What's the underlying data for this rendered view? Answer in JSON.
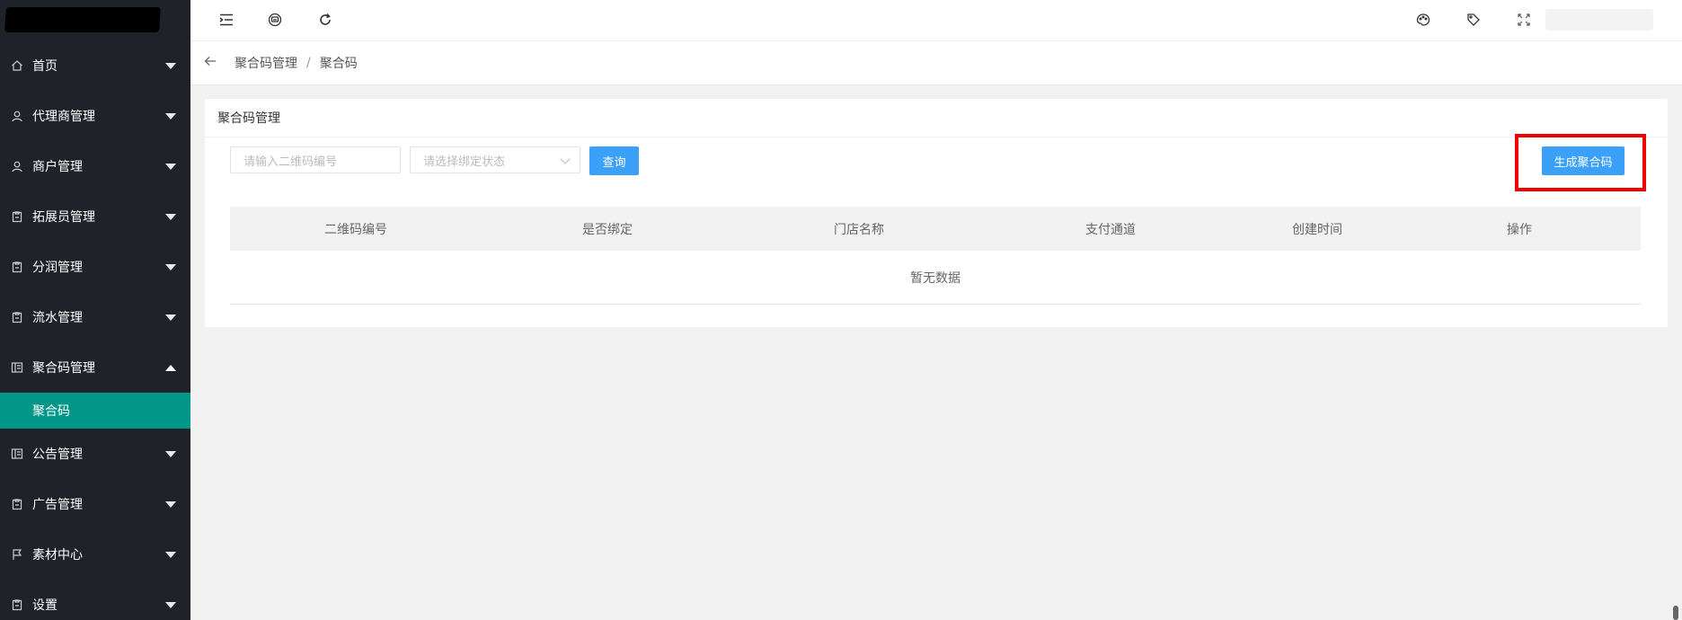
{
  "sidebar": {
    "items": [
      {
        "label": "首页",
        "icon": "home-icon",
        "state": "collapsed"
      },
      {
        "label": "代理商管理",
        "icon": "user-icon",
        "state": "collapsed"
      },
      {
        "label": "商户管理",
        "icon": "user-icon",
        "state": "collapsed"
      },
      {
        "label": "拓展员管理",
        "icon": "clipboard-icon",
        "state": "collapsed"
      },
      {
        "label": "分润管理",
        "icon": "clipboard-icon",
        "state": "collapsed"
      },
      {
        "label": "流水管理",
        "icon": "clipboard-icon",
        "state": "collapsed"
      },
      {
        "label": "聚合码管理",
        "icon": "form-icon",
        "state": "expanded"
      },
      {
        "label": "公告管理",
        "icon": "form-icon",
        "state": "collapsed"
      },
      {
        "label": "广告管理",
        "icon": "clipboard-icon",
        "state": "collapsed"
      },
      {
        "label": "素材中心",
        "icon": "flag-icon",
        "state": "collapsed"
      },
      {
        "label": "设置",
        "icon": "clipboard-icon",
        "state": "collapsed"
      }
    ],
    "active_sub": "聚合码"
  },
  "header": {
    "icons": [
      "menu-fold-icon",
      "website-icon",
      "refresh-icon",
      "theme-icon",
      "tag-icon",
      "fullscreen-icon"
    ]
  },
  "breadcrumb": {
    "parent": "聚合码管理",
    "separator": "/",
    "current": "聚合码"
  },
  "card": {
    "title": "聚合码管理",
    "search": {
      "qr_placeholder": "请输入二维码编号",
      "status_placeholder": "请选择绑定状态",
      "query_label": "查询"
    },
    "generate_label": "生成聚合码",
    "table": {
      "columns": [
        "二维码编号",
        "是否绑定",
        "门店名称",
        "支付通道",
        "创建时间",
        "操作"
      ],
      "empty_text": "暂无数据"
    }
  },
  "colors": {
    "sidebar_bg": "#20222a",
    "active_green": "#009688",
    "primary_blue": "#3ba0f7",
    "highlight_red": "#f20000"
  }
}
